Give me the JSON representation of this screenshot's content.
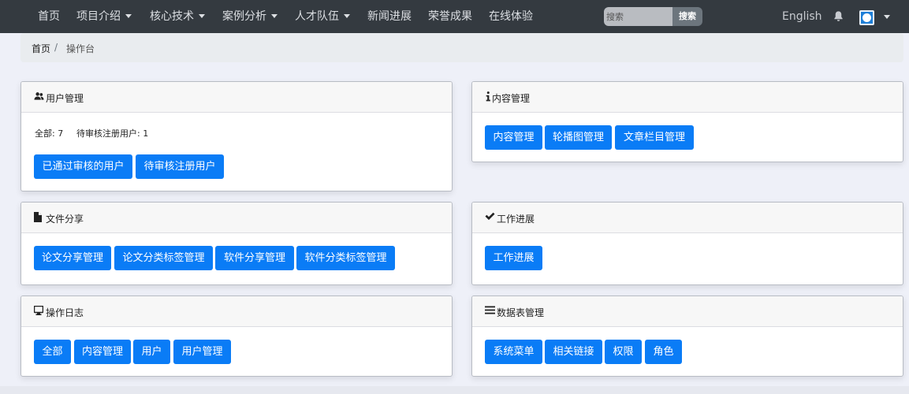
{
  "nav": {
    "items": [
      {
        "label": "首页",
        "dropdown": false
      },
      {
        "label": "项目介绍",
        "dropdown": true
      },
      {
        "label": "核心技术",
        "dropdown": true
      },
      {
        "label": "案例分析",
        "dropdown": true
      },
      {
        "label": "人才队伍",
        "dropdown": true
      },
      {
        "label": "新闻进展",
        "dropdown": false
      },
      {
        "label": "荣誉成果",
        "dropdown": false
      },
      {
        "label": "在线体验",
        "dropdown": false
      }
    ],
    "search_placeholder": "搜索",
    "search_button": "搜索",
    "language": "English",
    "bell_icon": "bell-icon",
    "avatar_icon": "user-avatar-icon"
  },
  "breadcrumb": {
    "home": "首页",
    "separator": "/",
    "current": "操作台"
  },
  "cards": {
    "users": {
      "icon": "users-icon",
      "title": "用户管理",
      "stat_all": "全部: 7",
      "stat_pending": "待审核注册用户: 1",
      "buttons": [
        "已通过审核的用户",
        "待审核注册用户"
      ]
    },
    "content": {
      "icon": "info-icon",
      "title": "内容管理",
      "buttons": [
        "内容管理",
        "轮播图管理",
        "文章栏目管理"
      ]
    },
    "files": {
      "icon": "file-icon",
      "title": "文件分享",
      "buttons": [
        "论文分享管理",
        "论文分类标签管理",
        "软件分享管理",
        "软件分类标签管理"
      ]
    },
    "progress": {
      "icon": "checkmark-icon",
      "title": "工作进展",
      "buttons": [
        "工作进展"
      ]
    },
    "logs": {
      "icon": "monitor-icon",
      "title": "操作日志",
      "buttons": [
        "全部",
        "内容管理",
        "用户",
        "用户管理"
      ]
    },
    "tables": {
      "icon": "list-icon",
      "title": "数据表管理",
      "buttons": [
        "系统菜单",
        "相关链接",
        "权限",
        "角色"
      ]
    }
  },
  "colors": {
    "navbar": "#343a40",
    "primary_button": "#0a7cf6",
    "page_background": "#eef0f8"
  }
}
